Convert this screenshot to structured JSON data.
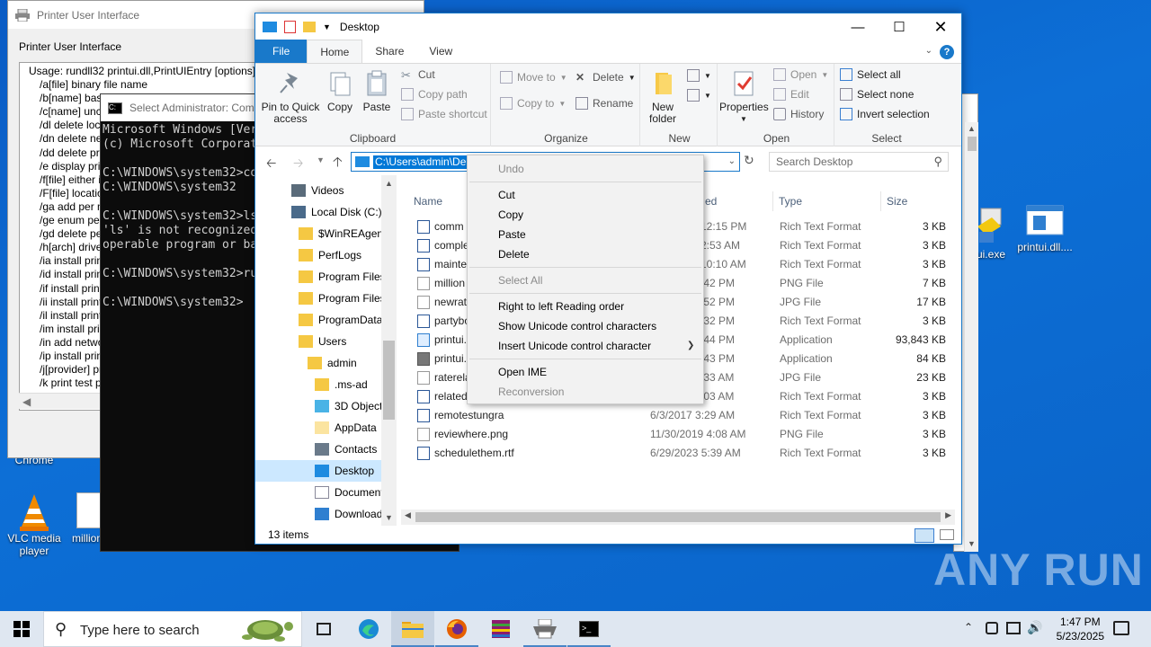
{
  "desktop": {
    "icons_left": [
      {
        "label": "Chrome",
        "icon": "chrome-icon"
      },
      {
        "label": "VLC media player",
        "icon": "vlc-icon"
      },
      {
        "label": "million",
        "icon": "image-file-icon"
      }
    ],
    "icons_right": [
      {
        "label": "ui.exe",
        "icon": "installer-icon"
      },
      {
        "label": "printui.dll....",
        "icon": "dll-file-icon"
      }
    ]
  },
  "printer_window": {
    "title": "Printer User Interface",
    "heading": "Printer User Interface",
    "usage_lines": [
      "Usage: rundll32 printui.dll,PrintUIEntry [options] [",
      "/a[file] binary file name",
      "/b[name] base",
      "/c[name] unc",
      "/dl delete loca",
      "/dn delete netw",
      "/dd delete prin",
      "/e display prin",
      "/f[file] either in",
      "/F[file] location",
      "/ga add per m",
      "/ge enum per",
      "/gd delete per",
      "/h[arch] driver",
      "/ia install print",
      "/id install print",
      "/if install print",
      "/ii install print",
      "/il install print",
      "/im install prin",
      "/in add netwo",
      "/ip install print",
      "/j[provider] pri",
      "/k print test pa"
    ]
  },
  "cmd_window": {
    "title": "Select Administrator: Comr",
    "lines": [
      "Microsoft Windows [Ver",
      "(c) Microsoft Corporat",
      "",
      "C:\\WINDOWS\\system32>co",
      "C:\\WINDOWS\\system32",
      "",
      "C:\\WINDOWS\\system32>ls",
      "'ls' is not recognized",
      "operable program or ba",
      "",
      "C:\\WINDOWS\\system32>ru",
      "",
      "C:\\WINDOWS\\system32>"
    ]
  },
  "explorer": {
    "title": "Desktop",
    "tabs": [
      "File",
      "Home",
      "Share",
      "View"
    ],
    "ribbon": {
      "clipboard": {
        "label": "Clipboard",
        "pin": "Pin to Quick access",
        "copy": "Copy",
        "paste": "Paste",
        "cut": "Cut",
        "copy_path": "Copy path",
        "paste_shortcut": "Paste shortcut"
      },
      "organize": {
        "label": "Organize",
        "move_to": "Move to",
        "copy_to": "Copy to",
        "delete": "Delete",
        "rename": "Rename"
      },
      "new": {
        "label": "New",
        "new_folder": "New folder"
      },
      "open": {
        "label": "Open",
        "properties": "Properties",
        "open": "Open",
        "edit": "Edit",
        "history": "History"
      },
      "select": {
        "label": "Select",
        "select_all": "Select all",
        "select_none": "Select none",
        "invert": "Invert selection"
      }
    },
    "address": "C:\\Users\\admin\\Desktop",
    "address_visible": "C:\\Users\\admin\\De",
    "search_placeholder": "Search Desktop",
    "nav_items": [
      {
        "label": "Videos",
        "level": 0
      },
      {
        "label": "Local Disk (C:)",
        "level": 0
      },
      {
        "label": "$WinREAgent",
        "level": 1
      },
      {
        "label": "PerfLogs",
        "level": 1
      },
      {
        "label": "Program Files",
        "level": 1
      },
      {
        "label": "Program Files",
        "level": 1
      },
      {
        "label": "ProgramData",
        "level": 1
      },
      {
        "label": "Users",
        "level": 1
      },
      {
        "label": "admin",
        "level": 2
      },
      {
        "label": ".ms-ad",
        "level": 3
      },
      {
        "label": "3D Objects",
        "level": 3
      },
      {
        "label": "AppData",
        "level": 3
      },
      {
        "label": "Contacts",
        "level": 3
      },
      {
        "label": "Desktop",
        "level": 3
      },
      {
        "label": "Documents",
        "level": 3
      },
      {
        "label": "Downloads",
        "level": 3
      }
    ],
    "columns": [
      "Name",
      "ed",
      "Type",
      "Size"
    ],
    "files": [
      {
        "name": "comm",
        "date": "12:15 PM",
        "type": "Rich Text Format",
        "size": "3 KB",
        "icon": "rtf"
      },
      {
        "name": "comple",
        "date": "2:53 AM",
        "type": "Rich Text Format",
        "size": "3 KB",
        "icon": "rtf"
      },
      {
        "name": "mainte",
        "date": "10:10 AM",
        "type": "Rich Text Format",
        "size": "3 KB",
        "icon": "rtf"
      },
      {
        "name": "million",
        "date": ":42 PM",
        "type": "PNG File",
        "size": "7 KB",
        "icon": "img"
      },
      {
        "name": "newrat",
        "date": ":52 PM",
        "type": "JPG File",
        "size": "17 KB",
        "icon": "img"
      },
      {
        "name": "partybo",
        "date": ":32 PM",
        "type": "Rich Text Format",
        "size": "3 KB",
        "icon": "rtf"
      },
      {
        "name": "printui.",
        "date": ":44 PM",
        "type": "Application",
        "size": "93,843 KB",
        "icon": "app"
      },
      {
        "name": "printui.",
        "date": ":43 PM",
        "type": "Application",
        "size": "84 KB",
        "icon": "printer"
      },
      {
        "name": "raterela",
        "date": ":33 AM",
        "type": "JPG File",
        "size": "23 KB",
        "icon": "img"
      },
      {
        "name": "related",
        "date": ":03 AM",
        "type": "Rich Text Format",
        "size": "3 KB",
        "icon": "rtf"
      },
      {
        "name": "remotestungra",
        "date": "6/3/2017 3:29 AM",
        "type": "Rich Text Format",
        "size": "3 KB",
        "icon": "rtf"
      },
      {
        "name": "reviewhere.png",
        "date": "11/30/2019 4:08 AM",
        "type": "PNG File",
        "size": "3 KB",
        "icon": "img"
      },
      {
        "name": "schedulethem.rtf",
        "date": "6/29/2023 5:39 AM",
        "type": "Rich Text Format",
        "size": "3 KB",
        "icon": "rtf"
      }
    ],
    "status": "13 items"
  },
  "context_menu": {
    "items": [
      {
        "label": "Undo",
        "enabled": false
      },
      {
        "sep": true
      },
      {
        "label": "Cut",
        "enabled": true
      },
      {
        "label": "Copy",
        "enabled": true
      },
      {
        "label": "Paste",
        "enabled": true
      },
      {
        "label": "Delete",
        "enabled": true
      },
      {
        "sep": true
      },
      {
        "label": "Select All",
        "enabled": false
      },
      {
        "sep": true
      },
      {
        "label": "Right to left Reading order",
        "enabled": true
      },
      {
        "label": "Show Unicode control characters",
        "enabled": true
      },
      {
        "label": "Insert Unicode control character",
        "enabled": true,
        "submenu": true
      },
      {
        "sep": true
      },
      {
        "label": "Open IME",
        "enabled": true
      },
      {
        "label": "Reconversion",
        "enabled": false
      }
    ]
  },
  "taskbar": {
    "search_text": "Type here to search",
    "time": "1:47 PM",
    "date": "5/23/2025"
  },
  "watermark": "ANY RUN",
  "colors": {
    "accent": "#1979ca",
    "selection": "#0078d7",
    "desktop": "#0d6fd6"
  }
}
